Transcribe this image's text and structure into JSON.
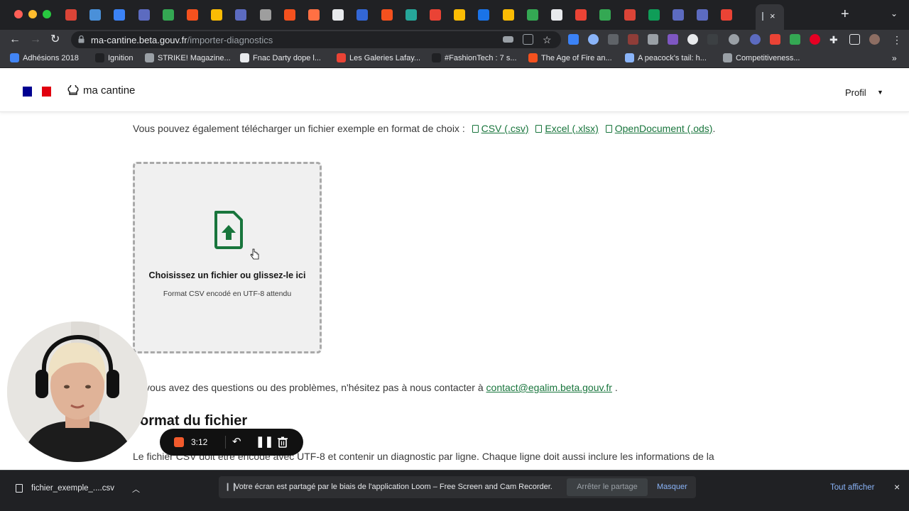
{
  "browser": {
    "url_host": "ma-cantine.beta.gouv.fr",
    "url_path": "/importer-diagnostics",
    "active_tab_close": "×",
    "new_tab": "+",
    "tab_colors": [
      "#db4437",
      "#4a90d9",
      "#3b82f6",
      "#5c6bc0",
      "#34a853",
      "#f4511e",
      "#fbbc04",
      "#5c6bc0",
      "#9e9e9e",
      "#f4511e",
      "#ff7043",
      "#e8eaed",
      "#3367d6",
      "#f4511e",
      "#26a69a",
      "#ea4335",
      "#fbbc04",
      "#1a73e8",
      "#fbbc04",
      "#34a853",
      "#e8eaed",
      "#ea4335",
      "#34a853",
      "#db4437",
      "#0f9d58",
      "#5c6bc0",
      "#5c6bc0",
      "#ea4335"
    ],
    "bookmarks": [
      {
        "label": "Adhésions 2018",
        "color": "#4285f4"
      },
      {
        "label": "Ignition",
        "color": "#202124"
      },
      {
        "label": "STRIKE! Magazine...",
        "color": "#9aa0a6"
      },
      {
        "label": "Fnac Darty dope l...",
        "color": "#e8eaed"
      },
      {
        "label": "Les Galeries Lafay...",
        "color": "#ea4335"
      },
      {
        "label": "#FashionTech : 7 s...",
        "color": "#202124"
      },
      {
        "label": "The Age of Fire an...",
        "color": "#f4511e"
      },
      {
        "label": "A peacock's tail: h...",
        "color": "#8ab4f8"
      },
      {
        "label": "Competitiveness...",
        "color": "#9aa0a6"
      }
    ],
    "bookmarks_more": "»"
  },
  "header": {
    "logo_text": "ma cantine",
    "profile_label": "Profil",
    "flag_colors": [
      "#000091",
      "#ffffff",
      "#e1000f"
    ]
  },
  "main": {
    "intro_text": "Vous pouvez également télécharger un fichier exemple en format de choix :",
    "download_links": [
      "CSV (.csv)",
      "Excel (.xlsx)",
      "OpenDocument (.ods)"
    ],
    "intro_end": ".",
    "dropzone": {
      "title": "Choisissez un fichier ou glissez-le ici",
      "hint": "Format CSV encodé en UTF-8 attendu",
      "icon_color": "#18753c"
    },
    "contact_text": "vous avez des questions ou des problèmes, n'hésitez pas à nous contacter à",
    "contact_email": "contact@egalim.beta.gouv.fr",
    "contact_end": ".",
    "section_title": "ormat du fichier",
    "body_text": "Le fichier CSV doit être encodé avec UTF-8 et contenir un diagnostic par ligne. Chaque ligne doit aussi inclure les informations de la"
  },
  "loom": {
    "timer": "3:12",
    "rec_color": "#f25a2c"
  },
  "download_shelf": {
    "file_name": "fichier_exemple_....csv",
    "share_text": "Votre écran est partagé par le biais de l'application Loom – Free Screen and Cam Recorder.",
    "stop_label": "Arrêter le partage",
    "hide_label": "Masquer",
    "show_all_label": "Tout afficher",
    "close": "×"
  }
}
